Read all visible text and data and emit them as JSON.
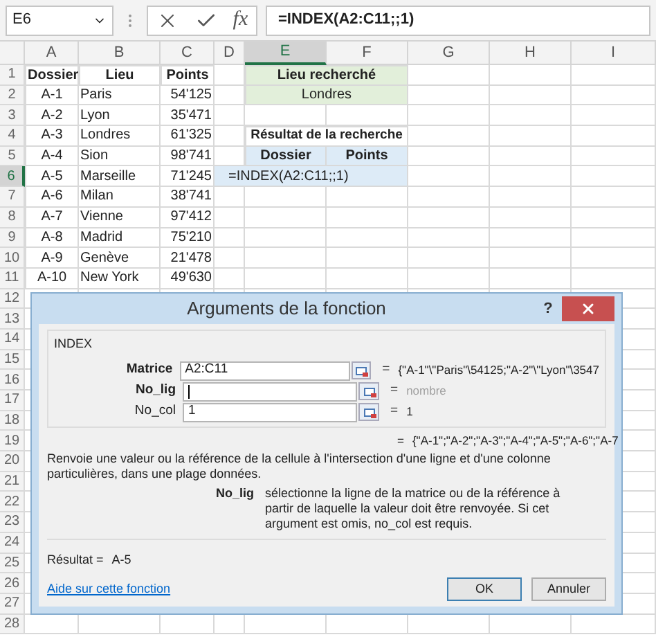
{
  "formula_bar": {
    "name_box": "E6",
    "fx_label": "fx",
    "formula": "=INDEX(A2:C11;;1)"
  },
  "columns": [
    {
      "label": "A",
      "selected": false
    },
    {
      "label": "B",
      "selected": false
    },
    {
      "label": "C",
      "selected": false
    },
    {
      "label": "D",
      "selected": false
    },
    {
      "label": "E",
      "selected": true
    },
    {
      "label": "F",
      "selected": false
    },
    {
      "label": "G",
      "selected": false
    },
    {
      "label": "H",
      "selected": false
    },
    {
      "label": "I",
      "selected": false
    }
  ],
  "row_numbers": [
    {
      "label": "1",
      "selected": false
    },
    {
      "label": "2",
      "selected": false
    },
    {
      "label": "3",
      "selected": false
    },
    {
      "label": "4",
      "selected": false
    },
    {
      "label": "5",
      "selected": false
    },
    {
      "label": "6",
      "selected": true
    },
    {
      "label": "7",
      "selected": false
    },
    {
      "label": "8",
      "selected": false
    },
    {
      "label": "9",
      "selected": false
    },
    {
      "label": "10",
      "selected": false
    },
    {
      "label": "11",
      "selected": false
    },
    {
      "label": "12",
      "selected": false
    },
    {
      "label": "13",
      "selected": false
    },
    {
      "label": "14",
      "selected": false
    },
    {
      "label": "15",
      "selected": false
    },
    {
      "label": "16",
      "selected": false
    },
    {
      "label": "17",
      "selected": false
    },
    {
      "label": "18",
      "selected": false
    },
    {
      "label": "19",
      "selected": false
    },
    {
      "label": "20",
      "selected": false
    },
    {
      "label": "21",
      "selected": false
    },
    {
      "label": "22",
      "selected": false
    },
    {
      "label": "23",
      "selected": false
    },
    {
      "label": "24",
      "selected": false
    },
    {
      "label": "25",
      "selected": false
    },
    {
      "label": "26",
      "selected": false
    },
    {
      "label": "27",
      "selected": false
    },
    {
      "label": "28",
      "selected": false
    }
  ],
  "table": {
    "columns": [
      "Dossier",
      "Lieu",
      "Points"
    ],
    "rows": [
      {
        "dossier": "A-1",
        "lieu": "Paris",
        "points": "54'125"
      },
      {
        "dossier": "A-2",
        "lieu": "Lyon",
        "points": "35'471"
      },
      {
        "dossier": "A-3",
        "lieu": "Londres",
        "points": "61'325"
      },
      {
        "dossier": "A-4",
        "lieu": "Sion",
        "points": "98'741"
      },
      {
        "dossier": "A-5",
        "lieu": "Marseille",
        "points": "71'245"
      },
      {
        "dossier": "A-6",
        "lieu": "Milan",
        "points": "38'741"
      },
      {
        "dossier": "A-7",
        "lieu": "Vienne",
        "points": "97'412"
      },
      {
        "dossier": "A-8",
        "lieu": "Madrid",
        "points": "75'210"
      },
      {
        "dossier": "A-9",
        "lieu": "Genève",
        "points": "21'478"
      },
      {
        "dossier": "A-10",
        "lieu": "New York",
        "points": "49'630"
      }
    ]
  },
  "search_box": {
    "header": "Lieu recherché",
    "value": "Londres"
  },
  "result_box": {
    "title": "Résultat de la recherche",
    "columns": [
      "Dossier",
      "Points"
    ],
    "editing_formula": "=INDEX(A2:C11;;1)"
  },
  "dialog": {
    "title": "Arguments de la fonction",
    "help_button": "?",
    "function_name": "INDEX",
    "arguments": [
      {
        "label": "Matrice",
        "required": true,
        "value": "A2:C11",
        "focused": false,
        "equals": "=",
        "result": "{\"A-1\"\\\"Paris\"\\54125;\"A-2\"\\\"Lyon\"\\3547",
        "result_dimmed": false
      },
      {
        "label": "No_lig",
        "required": true,
        "focused": true,
        "equals": "=",
        "result": "nombre",
        "result_dimmed": true
      },
      {
        "label": "No_col",
        "required": false,
        "value": "1",
        "focused": false,
        "equals": "=",
        "result": "1",
        "result_dimmed": false
      }
    ],
    "formula_result_equals": "=",
    "formula_result": "{\"A-1\";\"A-2\";\"A-3\";\"A-4\";\"A-5\";\"A-6\";\"A-7",
    "description": "Renvoie une valeur ou la référence de la cellule à l'intersection d'une ligne et d'une colonne particulières, dans une plage données.",
    "argument_help": {
      "name": "No_lig",
      "text": "sélectionne la ligne de la matrice ou de la référence à partir de laquelle la valeur doit être renvoyée. Si cet argument est omis, no_col est requis."
    },
    "result_label": "Résultat =",
    "result_value": "A-5",
    "help_link": "Aide sur cette fonction",
    "buttons": [
      {
        "label": "OK",
        "default": true
      },
      {
        "label": "Annuler",
        "default": false
      }
    ]
  }
}
